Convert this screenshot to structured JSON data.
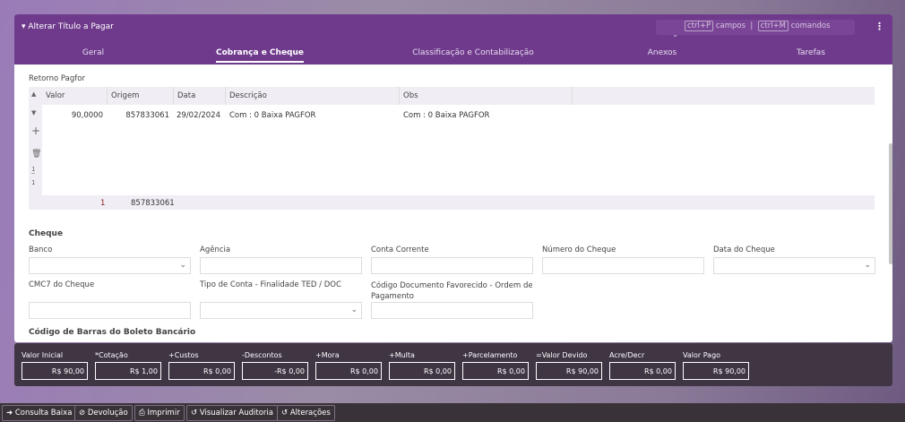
{
  "header": {
    "title": "Alterar Título a Pagar",
    "shortcut1_key": "ctrl+P",
    "shortcut1_label": "campos",
    "shortcut2_key": "ctrl+M",
    "shortcut2_label": "comandos"
  },
  "tabs": [
    {
      "label": "Geral"
    },
    {
      "label": "Cobrança e Cheque",
      "active": true
    },
    {
      "label": "Classificação e Contabilização"
    },
    {
      "label": "Anexos"
    },
    {
      "label": "Tarefas"
    }
  ],
  "retorno": {
    "title": "Retorno Pagfor",
    "columns": [
      "Valor",
      "Origem",
      "Data",
      "Descrição",
      "Obs"
    ],
    "rows": [
      {
        "valor": "90,0000",
        "origem": "857833061",
        "data": "29/02/2024",
        "descricao": "Com : 0 Baixa PAGFOR",
        "obs": "Com : 0 Baixa PAGFOR"
      }
    ],
    "page_current": "1",
    "page_total": "1",
    "footer_count": "1",
    "footer_origem": "857833061"
  },
  "cheque": {
    "title": "Cheque",
    "fields": [
      {
        "label": "Banco",
        "value": ""
      },
      {
        "label": "Agência",
        "value": ""
      },
      {
        "label": "Conta Corrente",
        "value": ""
      },
      {
        "label": "Número do Cheque",
        "value": ""
      },
      {
        "label": "Data do Cheque",
        "value": ""
      },
      {
        "label": "CMC7 do Cheque",
        "value": ""
      },
      {
        "label": "Tipo de Conta - Finalidade TED / DOC",
        "value": ""
      },
      {
        "label": "Código Documento Favorecido - Ordem de Pagamento",
        "value": ""
      }
    ]
  },
  "boleto": {
    "title": "Código de Barras do Boleto Bancário"
  },
  "totals": [
    {
      "label": "Valor Inicial",
      "value": "R$ 90,00"
    },
    {
      "label": "*Cotação",
      "value": "R$ 1,00"
    },
    {
      "label": "+Custos",
      "value": "R$ 0,00"
    },
    {
      "label": "-Descontos",
      "value": "-R$ 0,00"
    },
    {
      "label": "+Mora",
      "value": "R$ 0,00"
    },
    {
      "label": "+Multa",
      "value": "R$ 0,00"
    },
    {
      "label": "+Parcelamento",
      "value": "R$ 0,00"
    },
    {
      "label": "=Valor Devido",
      "value": "R$ 90,00"
    },
    {
      "label": "Acre/Decr",
      "value": "R$ 0,00"
    },
    {
      "label": "Valor Pago",
      "value": "R$ 90,00"
    }
  ],
  "toolbar": [
    {
      "label": "Consulta Baixa",
      "icon": "arrow-circle-icon"
    },
    {
      "label": "Devolução",
      "icon": "ban-icon"
    },
    {
      "label": "Imprimir",
      "icon": "printer-icon"
    },
    {
      "label": "Visualizar Auditoria",
      "icon": "history-icon"
    },
    {
      "label": "Alterações",
      "icon": "history-icon"
    }
  ]
}
